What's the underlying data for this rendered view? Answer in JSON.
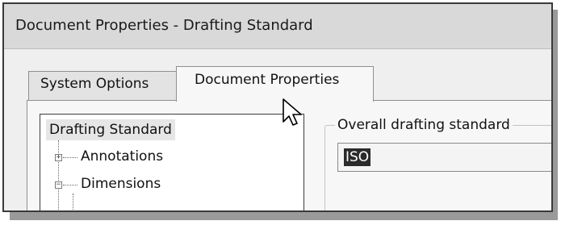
{
  "window": {
    "title": "Document Properties - Drafting Standard"
  },
  "tabs": [
    {
      "label": "System Options",
      "active": false
    },
    {
      "label": "Document Properties",
      "active": true
    }
  ],
  "tree": {
    "root": "Drafting Standard",
    "items": [
      {
        "label": "Annotations",
        "expander": "+"
      },
      {
        "label": "Dimensions",
        "expander": "−"
      }
    ]
  },
  "drafting_standard": {
    "group_label": "Overall drafting standard",
    "value": "ISO"
  },
  "colors": {
    "selection": "#2b2b2b",
    "window_frame": "#3a3a3a",
    "titlebar": "#d9d9d9"
  },
  "icons": [
    "arrow-cursor-icon",
    "expand-plus-icon",
    "collapse-minus-icon"
  ]
}
